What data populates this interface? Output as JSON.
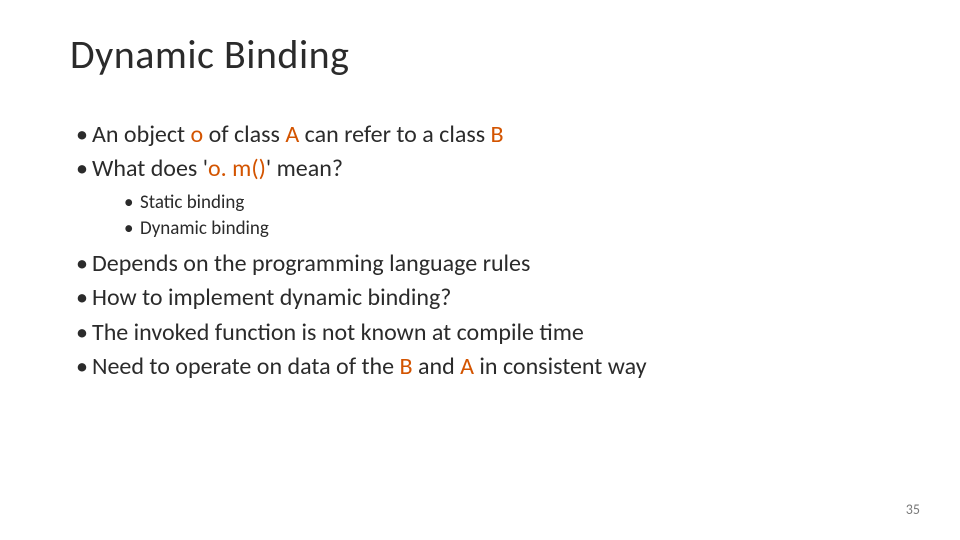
{
  "title": "Dynamic Binding",
  "accent_color": "#D35400",
  "bullets": {
    "b1": {
      "p1": "An object ",
      "o": "o",
      "p2": " of class ",
      "A": "A",
      "p3": " can refer to a class  ",
      "B": "B"
    },
    "b2": {
      "p1": "What does '",
      "code": "o. m()",
      "p2": "' mean?"
    },
    "sub1": "Static binding",
    "sub2": "Dynamic binding",
    "b3": "Depends on the programming language rules",
    "b4": "How to implement dynamic binding?",
    "b5": "The invoked function is not known at compile time",
    "b6": {
      "p1": "Need to operate on data of the ",
      "B": "B",
      "p2": " and ",
      "A": "A",
      "p3": " in consistent way"
    }
  },
  "page_number": "35"
}
